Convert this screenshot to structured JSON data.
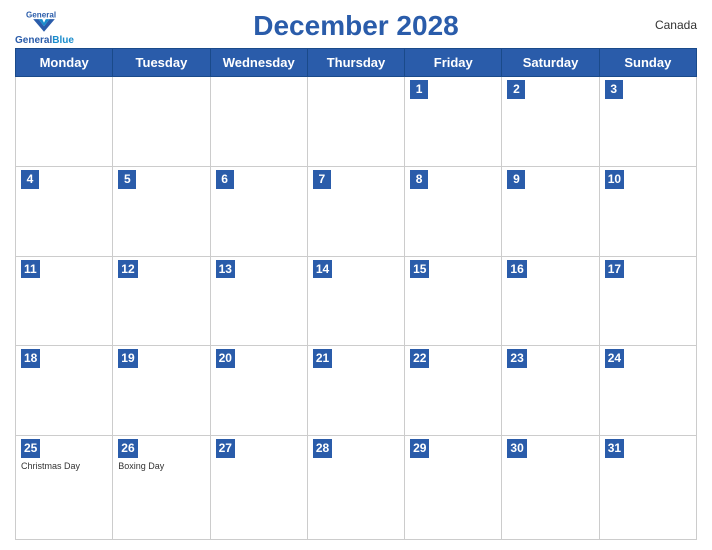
{
  "header": {
    "title": "December 2028",
    "country": "Canada",
    "logo_brand": "General",
    "logo_color": "Blue"
  },
  "weekdays": [
    "Monday",
    "Tuesday",
    "Wednesday",
    "Thursday",
    "Friday",
    "Saturday",
    "Sunday"
  ],
  "weeks": [
    [
      {
        "day": "",
        "empty": true
      },
      {
        "day": "",
        "empty": true
      },
      {
        "day": "",
        "empty": true
      },
      {
        "day": "",
        "empty": true
      },
      {
        "day": "1"
      },
      {
        "day": "2"
      },
      {
        "day": "3"
      }
    ],
    [
      {
        "day": "4"
      },
      {
        "day": "5"
      },
      {
        "day": "6"
      },
      {
        "day": "7"
      },
      {
        "day": "8"
      },
      {
        "day": "9"
      },
      {
        "day": "10"
      }
    ],
    [
      {
        "day": "11"
      },
      {
        "day": "12"
      },
      {
        "day": "13"
      },
      {
        "day": "14"
      },
      {
        "day": "15"
      },
      {
        "day": "16"
      },
      {
        "day": "17"
      }
    ],
    [
      {
        "day": "18"
      },
      {
        "day": "19"
      },
      {
        "day": "20"
      },
      {
        "day": "21"
      },
      {
        "day": "22"
      },
      {
        "day": "23"
      },
      {
        "day": "24"
      }
    ],
    [
      {
        "day": "25",
        "event": "Christmas Day"
      },
      {
        "day": "26",
        "event": "Boxing Day"
      },
      {
        "day": "27"
      },
      {
        "day": "28"
      },
      {
        "day": "29"
      },
      {
        "day": "30"
      },
      {
        "day": "31"
      }
    ]
  ]
}
